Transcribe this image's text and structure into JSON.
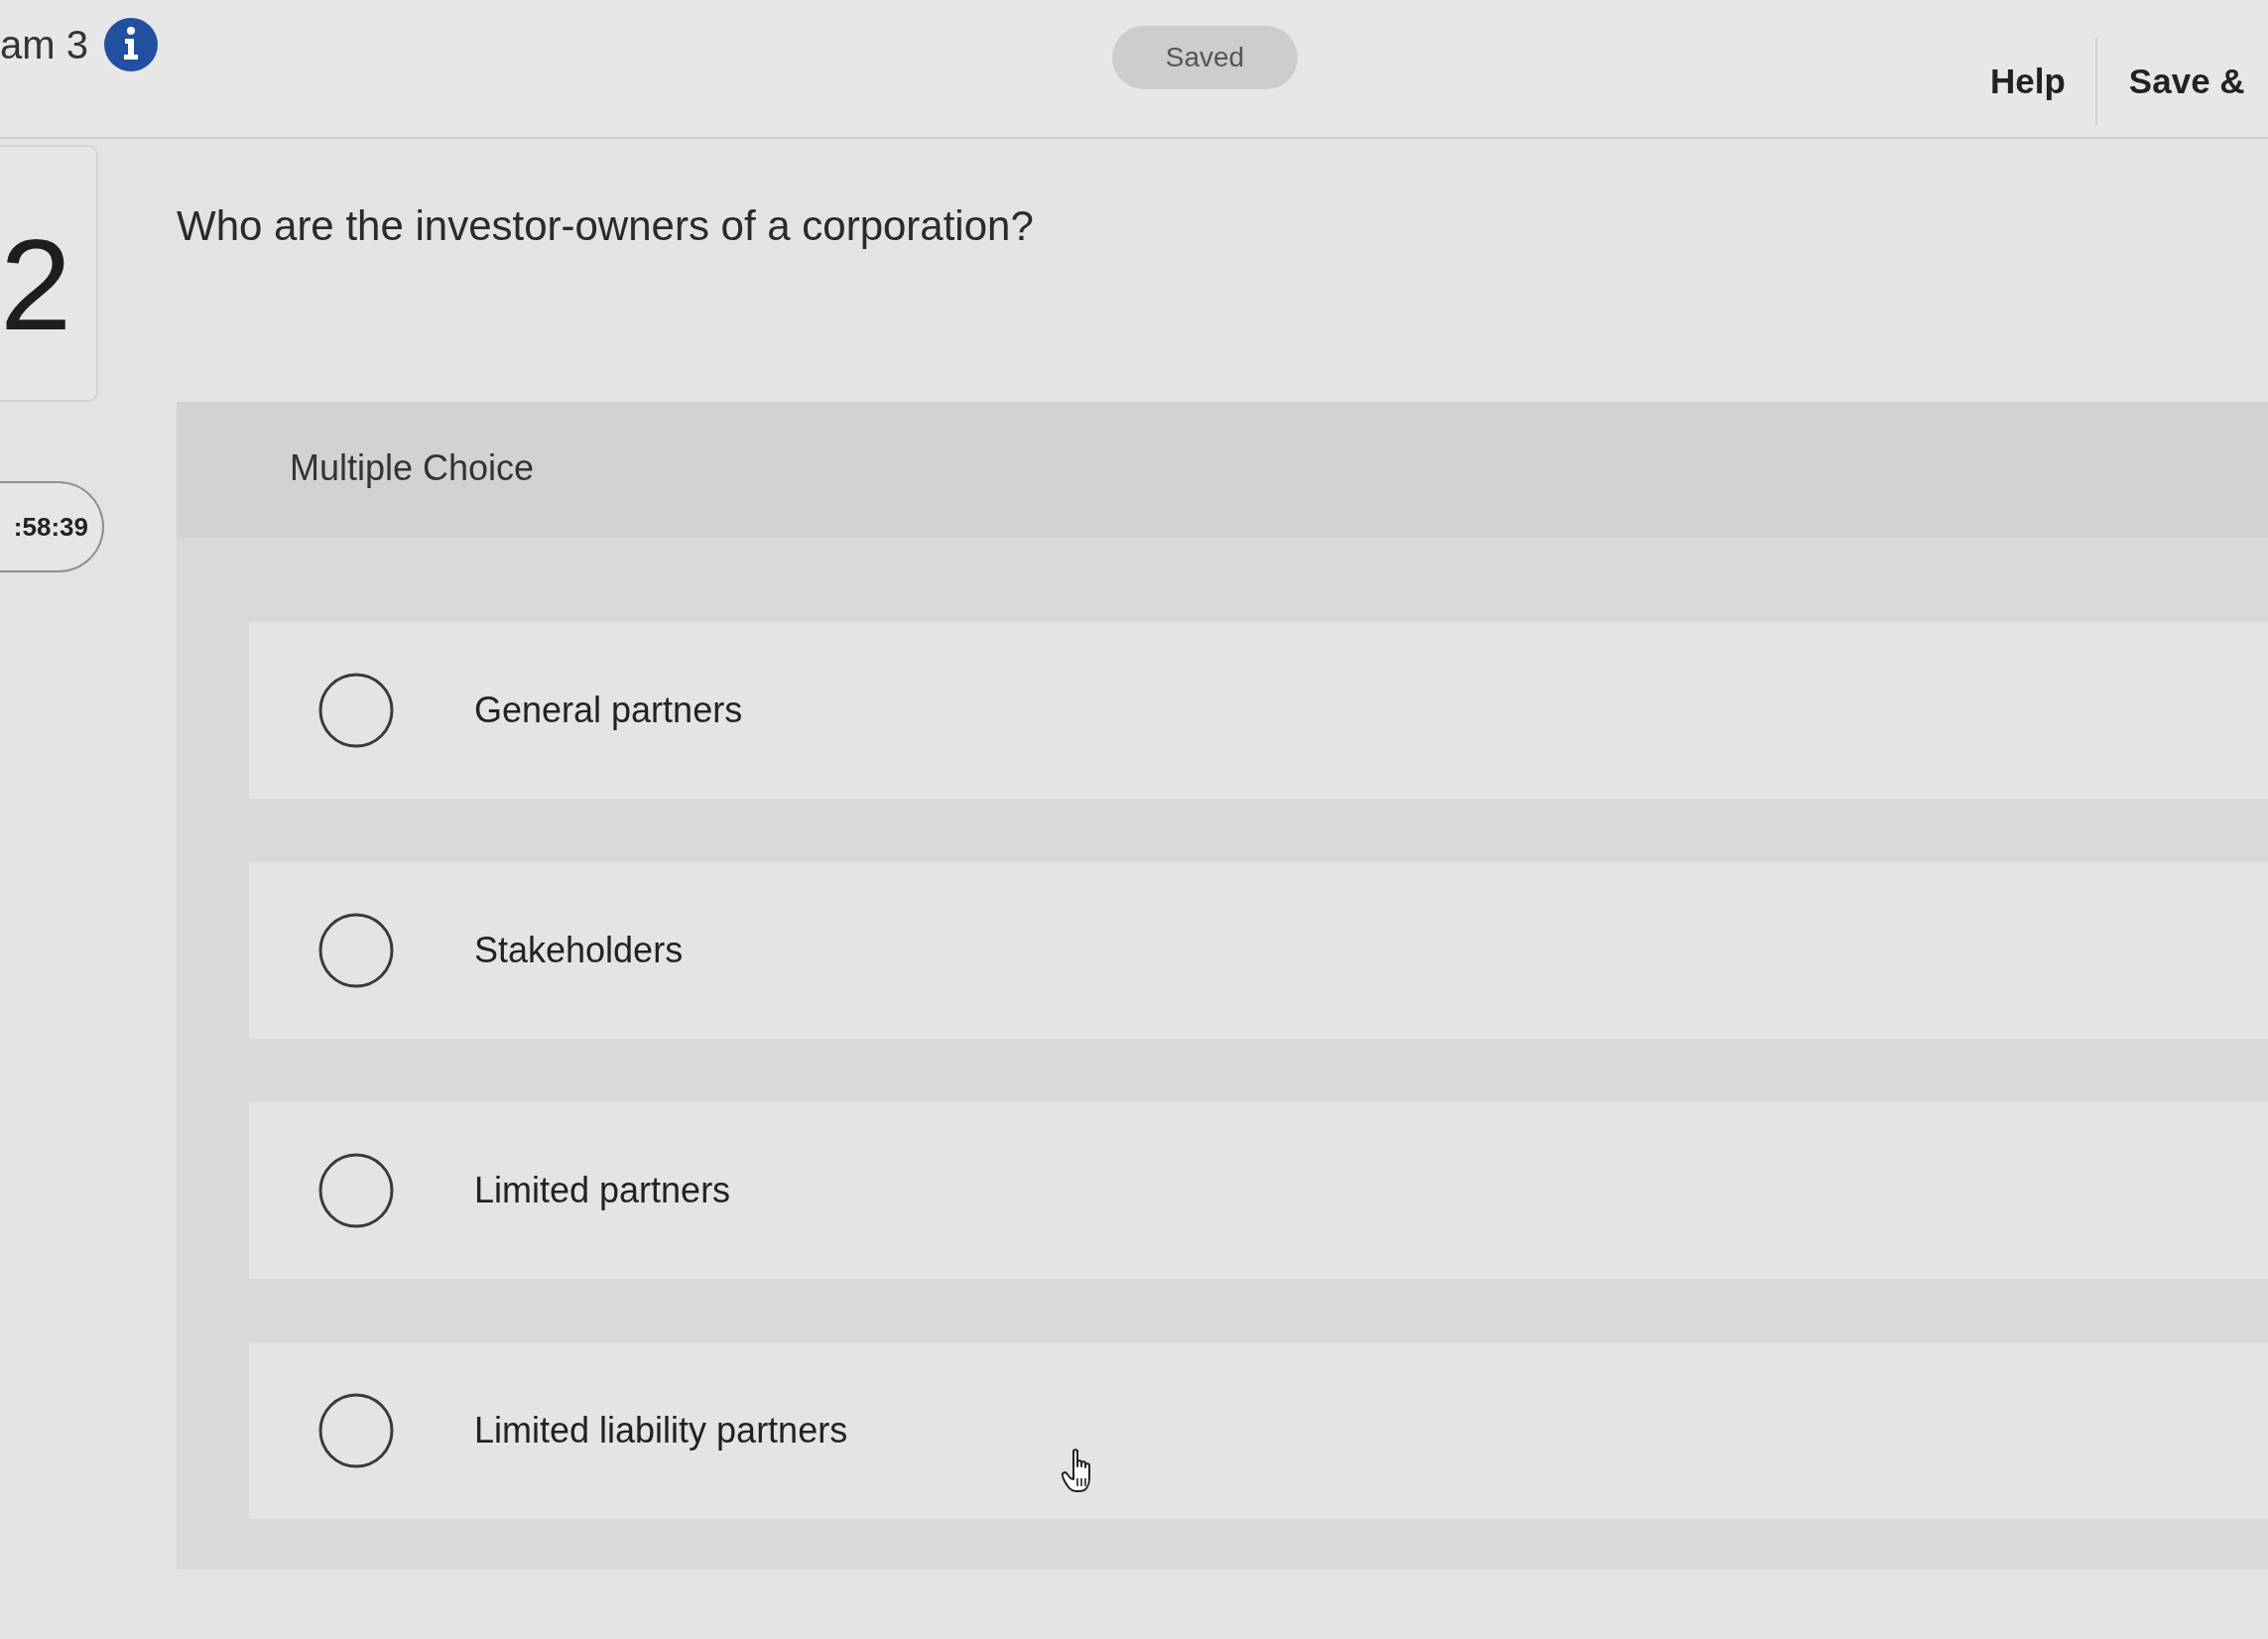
{
  "header": {
    "title": "am 3",
    "status": "Saved",
    "actions": [
      "Help",
      "Save &"
    ]
  },
  "question": {
    "number": "2",
    "timer": ":58:39",
    "text": "Who are the investor-owners of a corporation?"
  },
  "answer_panel": {
    "type_label": "Multiple Choice",
    "options": [
      {
        "label": "General partners",
        "selected": false
      },
      {
        "label": "Stakeholders",
        "selected": false
      },
      {
        "label": "Limited partners",
        "selected": false
      },
      {
        "label": "Limited liability partners",
        "selected": false
      }
    ]
  }
}
